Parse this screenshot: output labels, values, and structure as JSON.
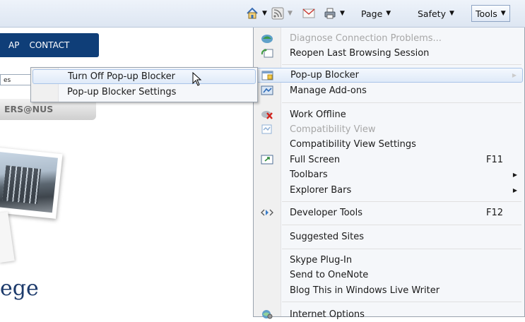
{
  "toolbar": {
    "page_label": "Page",
    "safety_label": "Safety",
    "tools_label": "Tools"
  },
  "page": {
    "nav_items": [
      "AP",
      "CONTACT"
    ],
    "search_value": "es",
    "careers_tab": "ERS@NUS",
    "college_text": "ege"
  },
  "tools_menu": {
    "items": [
      {
        "label": "Diagnose Connection Problems...",
        "disabled": true,
        "icon": "diagnose-icon"
      },
      {
        "label": "Reopen Last Browsing Session",
        "icon": "reopen-session-icon"
      },
      {
        "label": "Pop-up Blocker",
        "icon": "popup-blocker-icon",
        "submenu": true
      },
      {
        "label": "Manage Add-ons",
        "icon": "manage-addons-icon"
      },
      {
        "label": "Work Offline",
        "icon": "work-offline-icon"
      },
      {
        "label": "Compatibility View",
        "disabled": true,
        "icon": "compatibility-view-icon"
      },
      {
        "label": "Compatibility View Settings"
      },
      {
        "label": "Full Screen",
        "shortcut": "F11",
        "icon": "full-screen-icon"
      },
      {
        "label": "Toolbars",
        "submenu": true
      },
      {
        "label": "Explorer Bars",
        "submenu": true
      },
      {
        "label": "Developer Tools",
        "shortcut": "F12",
        "icon": "developer-tools-icon"
      },
      {
        "label": "Suggested Sites"
      },
      {
        "label": "Skype Plug-In"
      },
      {
        "label": "Send to OneNote"
      },
      {
        "label": "Blog This in Windows Live Writer"
      },
      {
        "label": "Internet Options",
        "icon": "internet-options-icon"
      }
    ]
  },
  "popup_submenu": {
    "items": [
      {
        "label": "Turn Off Pop-up Blocker"
      },
      {
        "label": "Pop-up Blocker Settings"
      }
    ]
  }
}
